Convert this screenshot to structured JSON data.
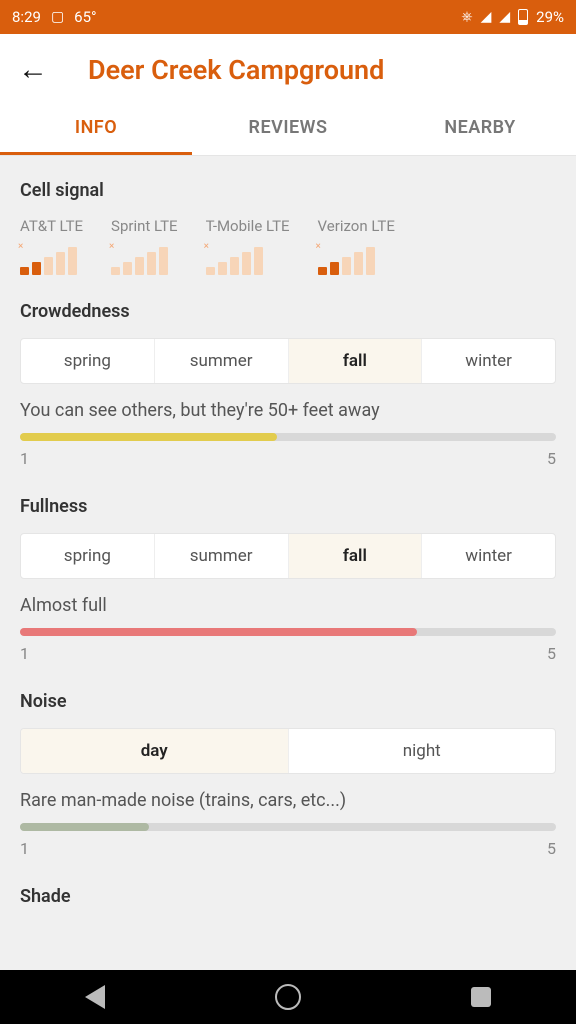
{
  "status": {
    "time": "8:29",
    "temp": "65°",
    "battery": "29%"
  },
  "header": {
    "title": "Deer Creek Campground"
  },
  "tabs": [
    {
      "label": "INFO",
      "active": true
    },
    {
      "label": "REVIEWS",
      "active": false
    },
    {
      "label": "NEARBY",
      "active": false
    }
  ],
  "cell_signal": {
    "title": "Cell signal",
    "carriers": [
      {
        "label": "AT&T LTE",
        "bars": 2,
        "total": 5
      },
      {
        "label": "Sprint LTE",
        "bars": 0,
        "total": 5
      },
      {
        "label": "T-Mobile LTE",
        "bars": 0,
        "total": 5
      },
      {
        "label": "Verizon LTE",
        "bars": 2,
        "total": 5
      }
    ]
  },
  "crowdedness": {
    "title": "Crowdedness",
    "seasons": [
      "spring",
      "summer",
      "fall",
      "winter"
    ],
    "selected": "fall",
    "desc": "You can see others, but they're 50+ feet away",
    "value": 2.4,
    "min": 1,
    "max": 5,
    "color": "#e2cc4d",
    "percent": 48
  },
  "fullness": {
    "title": "Fullness",
    "seasons": [
      "spring",
      "summer",
      "fall",
      "winter"
    ],
    "selected": "fall",
    "desc": "Almost full",
    "value": 4,
    "min": 1,
    "max": 5,
    "color": "#e87878",
    "percent": 74
  },
  "noise": {
    "title": "Noise",
    "options": [
      "day",
      "night"
    ],
    "selected": "day",
    "desc": "Rare man-made noise (trains, cars, etc...)",
    "value": 1.6,
    "min": 1,
    "max": 5,
    "color": "#aeb9a3",
    "percent": 24
  },
  "shade": {
    "title": "Shade"
  }
}
